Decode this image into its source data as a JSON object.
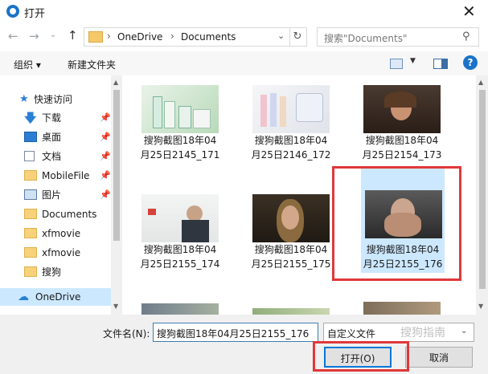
{
  "window": {
    "title": "打开"
  },
  "nav": {
    "path": [
      "OneDrive",
      "Documents"
    ],
    "search_placeholder": "搜索\"Documents\""
  },
  "toolbar": {
    "organize": "组织 ▾",
    "new_folder": "新建文件夹"
  },
  "sidebar": {
    "items": [
      {
        "label": "快速访问",
        "icon": "star-icon"
      },
      {
        "label": "下载",
        "icon": "download-icon",
        "pinned": true
      },
      {
        "label": "桌面",
        "icon": "desktop-icon",
        "pinned": true
      },
      {
        "label": "文档",
        "icon": "document-icon",
        "pinned": true
      },
      {
        "label": "MobileFile",
        "icon": "folder-icon",
        "pinned": true
      },
      {
        "label": "图片",
        "icon": "picture-icon",
        "pinned": true
      },
      {
        "label": "Documents",
        "icon": "folder-icon"
      },
      {
        "label": "xfmovie",
        "icon": "folder-icon"
      },
      {
        "label": "xfmovie",
        "icon": "folder-icon"
      },
      {
        "label": "搜狗",
        "icon": "folder-icon"
      },
      {
        "label": "OneDrive",
        "icon": "cloud-icon",
        "selected": true
      }
    ]
  },
  "files": [
    {
      "line1": "搜狗截图18年04",
      "line2": "月25日2145_171"
    },
    {
      "line1": "搜狗截图18年04",
      "line2": "月25日2146_172"
    },
    {
      "line1": "搜狗截图18年04",
      "line2": "月25日2154_173"
    },
    {
      "line1": "搜狗截图18年04",
      "line2": "月25日2155_174"
    },
    {
      "line1": "搜狗截图18年04",
      "line2": "月25日2155_175"
    },
    {
      "line1": "搜狗截图18年04",
      "line2": "月25日2155_176",
      "selected": true
    }
  ],
  "bottom": {
    "filename_label": "文件名(N):",
    "filename_value": "搜狗截图18年04月25日2155_176",
    "filter": "自定义文件",
    "open": "打开(O)",
    "cancel": "取消",
    "watermark": "搜狗指南"
  },
  "colors": {
    "highlight": "#e0383a",
    "selection": "#cce8ff",
    "accent": "#1a73c9"
  }
}
